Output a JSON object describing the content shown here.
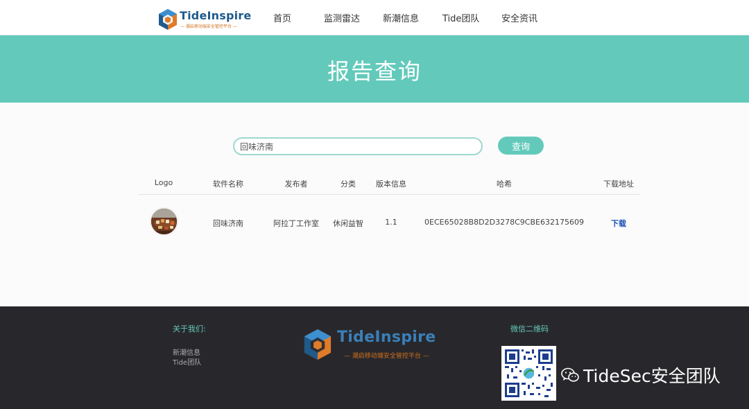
{
  "brand": {
    "name": "TideInspire",
    "tagline": "— 潮启移动端安全管控平台 —"
  },
  "nav": {
    "items": [
      "首页",
      "监测雷达",
      "新潮信息",
      "Tide团队",
      "安全资讯"
    ]
  },
  "banner": {
    "title": "报告查询"
  },
  "search": {
    "value": "回味济南",
    "button_label": "查询"
  },
  "table": {
    "headers": [
      "Logo",
      "软件名称",
      "发布者",
      "分类",
      "版本信息",
      "哈希",
      "下载地址"
    ],
    "rows": [
      {
        "name": "回味济南",
        "publisher": "阿拉丁工作室",
        "category": "休闲益智",
        "version": "1.1",
        "hash": "0ECE65028B8D2D3278C9CBE632175609",
        "download": "下载"
      }
    ]
  },
  "footer": {
    "about_title": "关于我们:",
    "links": [
      "新潮信息",
      "Tide团队"
    ],
    "brand_name": "TideInspire",
    "brand_tagline": "— 潮启移动端安全管控平台 —",
    "qr_title": "微信二维码"
  },
  "watermark": {
    "text": "TideSec安全团队"
  },
  "colors": {
    "accent": "#63cabb",
    "footer_bg": "#28282c",
    "link": "#1a4fb5",
    "brand_blue": "#1f5a8c",
    "brand_orange": "#d0701c"
  }
}
